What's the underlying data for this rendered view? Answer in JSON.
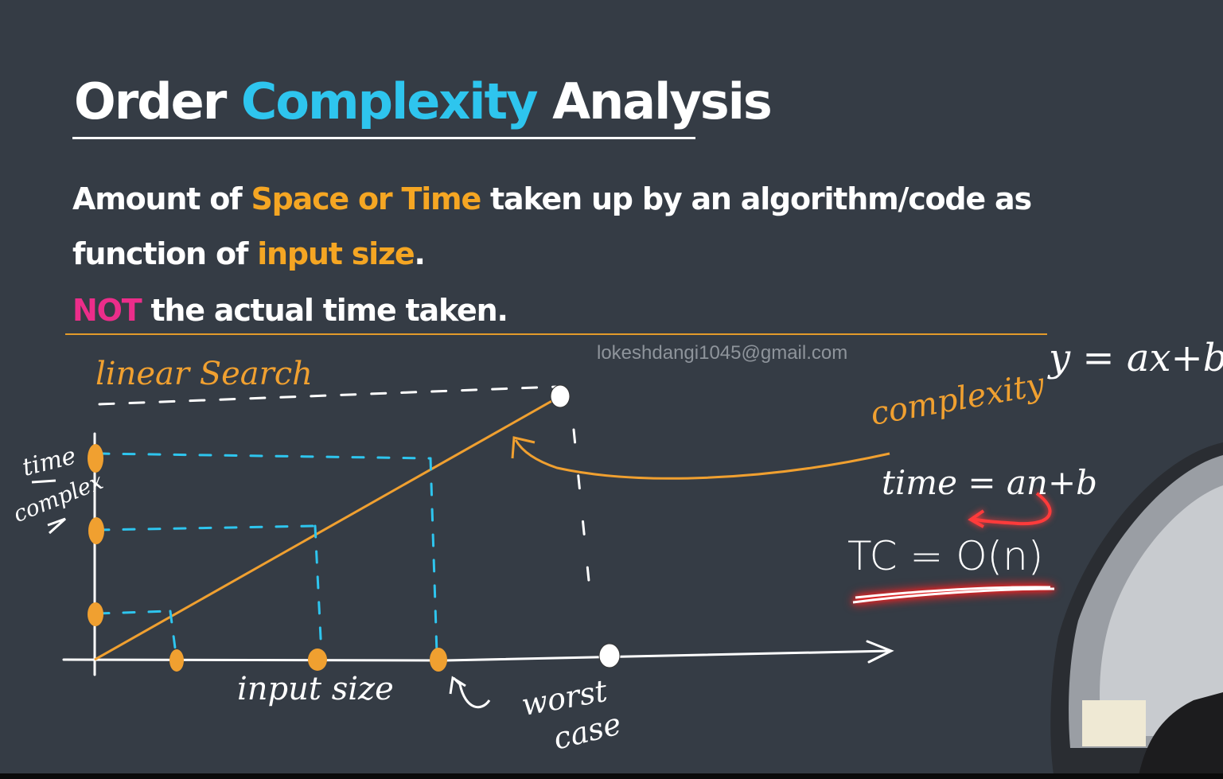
{
  "slide": {
    "title": {
      "part1": "Order ",
      "part2": "Complexity",
      "part3": " Analysis"
    },
    "definition": {
      "line1_a": "Amount of ",
      "line1_b": "Space or Time",
      "line1_c": " taken up by an algorithm/code as",
      "line2_a": "function of ",
      "line2_b": "input size",
      "line2_c": ".",
      "line3_a": "NOT",
      "line3_b": " the actual time taken."
    },
    "watermark": "lokeshdangi1045@gmail.com"
  },
  "handwriting": {
    "linear_search": "linear Search",
    "time_complex_1": "time",
    "time_complex_2": "complex",
    "input_size": "input size",
    "worst_1": "worst",
    "worst_2": "case",
    "complexity": "complexity",
    "y_eq": "y = ax+b",
    "time_eq": "time = an+b",
    "tc_eq": "TC = O(n)"
  },
  "colors": {
    "background": "#353c45",
    "cyan": "#2ec5ee",
    "orange": "#f5a623",
    "pink": "#ec2d8a",
    "red_highlight": "#ff3b3b"
  }
}
